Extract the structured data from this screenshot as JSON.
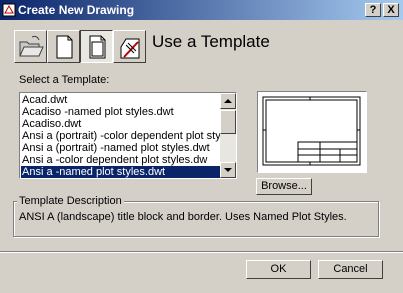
{
  "window": {
    "title": "Create New Drawing",
    "help_button": "?",
    "close_button": "X"
  },
  "toolbar": {
    "buttons": [
      {
        "name": "open-drawing",
        "icon": "open-folder-icon"
      },
      {
        "name": "start-from-scratch",
        "icon": "blank-page-icon"
      },
      {
        "name": "use-a-template",
        "icon": "template-page-icon",
        "active": true
      },
      {
        "name": "use-a-wizard",
        "icon": "wizard-icon"
      }
    ]
  },
  "main": {
    "heading": "Use a Template",
    "select_label": "Select a Template:",
    "templates": [
      "Acad.dwt",
      "Acadiso -named plot styles.dwt",
      "Acadiso.dwt",
      "Ansi a (portrait) -color dependent plot styles.dw",
      "Ansi a (portrait) -named plot styles.dwt",
      "Ansi a -color dependent plot styles.dw",
      "Ansi a -named plot styles.dwt"
    ],
    "selected_index": 6,
    "browse_label": "Browse...",
    "description_legend": "Template Description",
    "description_text": "ANSI A (landscape) title block and border.  Uses Named Plot Styles."
  },
  "footer": {
    "ok_label": "OK",
    "cancel_label": "Cancel"
  },
  "colors": {
    "titlebar_start": "#0a246a",
    "titlebar_end": "#a6caf0",
    "selection": "#0a246a",
    "face": "#d4d0c8"
  }
}
